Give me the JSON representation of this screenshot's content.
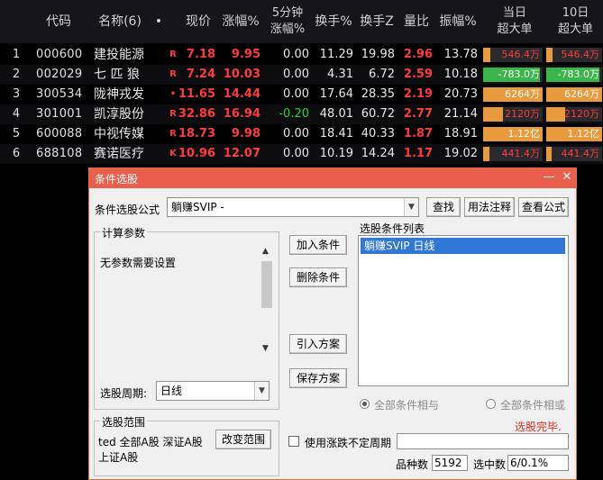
{
  "table": {
    "headers": {
      "code": "代码",
      "name": "名称(6)",
      "dot": "•",
      "price": "现价",
      "change": "涨幅%",
      "speed": "5分钟\n涨幅%",
      "turnover": "换手%",
      "turnover_z": "换手Z",
      "vol_ratio": "量比",
      "amplitude": "振幅%",
      "day_big": "当日\n超大单",
      "ten_day_big": "10日\n超大单"
    },
    "rows": [
      {
        "idx": "1",
        "code": "000600",
        "name": "建投能源",
        "flag": "R",
        "price": "7.18",
        "change": "9.95",
        "speed": "0.00",
        "turnover": "11.29",
        "turnover_z": "19.98",
        "vol_ratio": "2.96",
        "amplitude": "13.78",
        "day_big": "546.4万",
        "day_big_dir": "up",
        "day_big_frac": 0.12,
        "ten_big": "546.4万",
        "ten_big_dir": "up",
        "ten_big_frac": 0.12
      },
      {
        "idx": "2",
        "code": "002029",
        "name": "七 匹 狼",
        "flag": "R",
        "price": "7.24",
        "change": "10.03",
        "speed": "0.00",
        "turnover": "4.31",
        "turnover_z": "6.72",
        "vol_ratio": "2.59",
        "amplitude": "10.18",
        "day_big": "-783.0万",
        "day_big_dir": "down",
        "day_big_frac": 0.95,
        "ten_big": "-783.0万",
        "ten_big_dir": "down",
        "ten_big_frac": 0.95
      },
      {
        "idx": "3",
        "code": "300534",
        "name": "陇神戎发",
        "flag": "•",
        "price": "11.65",
        "change": "14.44",
        "speed": "0.00",
        "turnover": "17.64",
        "turnover_z": "28.35",
        "vol_ratio": "2.19",
        "amplitude": "20.73",
        "day_big": "6264万",
        "day_big_dir": "up",
        "day_big_frac": 1.0,
        "ten_big": "6264万",
        "ten_big_dir": "up",
        "ten_big_frac": 1.0
      },
      {
        "idx": "4",
        "code": "301001",
        "name": "凯淳股份",
        "flag": "R",
        "price": "32.86",
        "change": "16.94",
        "speed": "-0.20",
        "turnover": "48.01",
        "turnover_z": "60.72",
        "vol_ratio": "2.77",
        "amplitude": "21.14",
        "day_big": "2120万",
        "day_big_dir": "up",
        "day_big_frac": 0.34,
        "ten_big": "2120万",
        "ten_big_dir": "up",
        "ten_big_frac": 0.34
      },
      {
        "idx": "5",
        "code": "600088",
        "name": "中视传媒",
        "flag": "R",
        "price": "18.73",
        "change": "9.98",
        "speed": "0.00",
        "turnover": "18.41",
        "turnover_z": "40.33",
        "vol_ratio": "1.87",
        "amplitude": "18.91",
        "day_big": "1.12亿",
        "day_big_dir": "up",
        "day_big_frac": 1.0,
        "ten_big": "1.12亿",
        "ten_big_dir": "up",
        "ten_big_frac": 1.0
      },
      {
        "idx": "6",
        "code": "688108",
        "name": "赛诺医疗",
        "flag": "K",
        "price": "10.96",
        "change": "12.07",
        "speed": "0.00",
        "turnover": "10.19",
        "turnover_z": "14.24",
        "vol_ratio": "1.17",
        "amplitude": "19.02",
        "day_big": "441.4万",
        "day_big_dir": "up",
        "day_big_frac": 0.1,
        "ten_big": "441.4万",
        "ten_big_dir": "up",
        "ten_big_frac": 0.1
      }
    ]
  },
  "dialog": {
    "title": "条件选股",
    "min_icon": "—",
    "close_icon": "✕",
    "formula_label": "条件选股公式",
    "formula_value": "躺赚SVIP    -",
    "find_btn": "查找",
    "usage_btn": "用法注释",
    "view_btn": "查看公式",
    "params_group": "计算参数",
    "params_text": "无参数需要设置",
    "period_label": "选股周期:",
    "period_value": "日线",
    "add_btn": "加入条件",
    "del_btn": "删除条件",
    "import_btn": "引入方案",
    "save_btn": "保存方案",
    "cond_list_label": "选股条件列表",
    "cond_item": "躺赚SVIP  日线",
    "radio_and": "全部条件相与",
    "radio_or": "全部条件相或",
    "status": "选股完毕.",
    "range_group": "选股范围",
    "range_text_1": "ted 全部A股 深证A股",
    "range_text_2": "上证A股",
    "change_range_btn": "改变范围",
    "uncertain_label": "使用涨跌不定周期",
    "count_label": "品种数",
    "count_value": "5192",
    "selected_label": "选中数",
    "selected_value": "6/0.1%"
  },
  "colors": {
    "up": "#ff3b3b",
    "down": "#2bd42b",
    "bar_up": "#e89a3c",
    "bar_down": "#3ab54a",
    "title_bar": "#e95f4c",
    "selection": "#3077d6"
  }
}
